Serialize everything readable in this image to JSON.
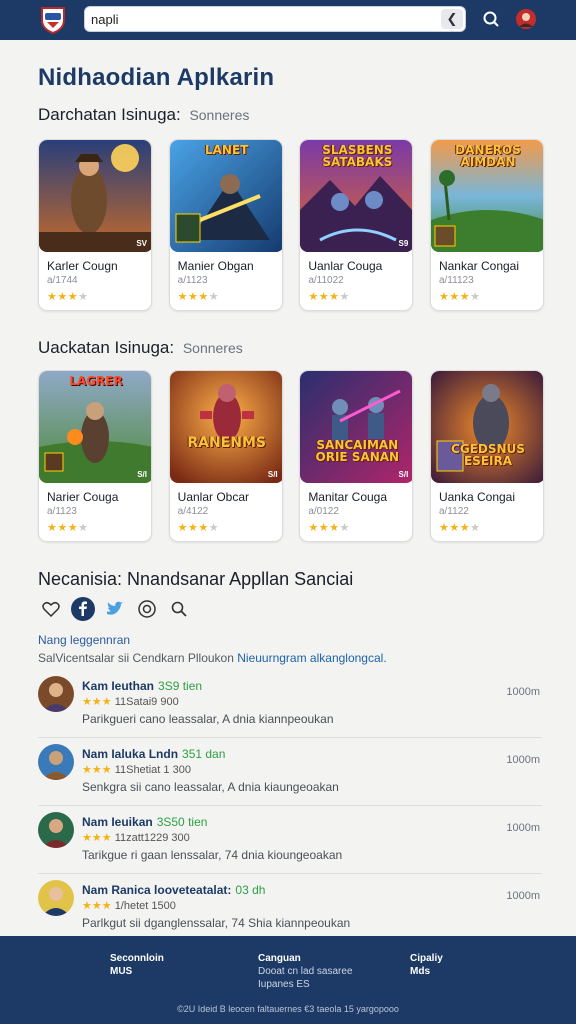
{
  "search": {
    "value": "napli"
  },
  "page_title": "Nidhaodian Aplkarin",
  "sections": [
    {
      "title": "Darchatan Isinuga:",
      "subtitle": "Sonneres",
      "cards": [
        {
          "caption": "",
          "badge": "SV",
          "name": "Karler Cougn",
          "date": "a/1744",
          "rating": 3
        },
        {
          "caption": "LANET",
          "badge": "",
          "name": "Manier Obgan",
          "date": "a/1123",
          "rating": 3
        },
        {
          "caption": "SLASBENS SATABAKS",
          "badge": "S9",
          "name": "Uanlar Couga",
          "date": "a/11022",
          "rating": 3
        },
        {
          "caption": "DANEROS AIMDAN",
          "badge": "",
          "name": "Nankar Congai",
          "date": "a/11123",
          "rating": 3
        }
      ]
    },
    {
      "title": "Uackatan Isinuga:",
      "subtitle": "Sonneres",
      "cards": [
        {
          "caption": "LAGRER",
          "badge": "S/I",
          "name": "Narier Couga",
          "date": "a/1123",
          "rating": 3
        },
        {
          "caption": "RANENMS",
          "badge": "S/I",
          "name": "Uanlar Obcar",
          "date": "a/4122",
          "rating": 3
        },
        {
          "caption": "SANCAIMAN ORIE SANAN",
          "badge": "S/I",
          "name": "Manitar Couga",
          "date": "a/0122",
          "rating": 3
        },
        {
          "caption": "CGEDSNUS ESEIRA",
          "badge": "",
          "name": "Uanka Congai",
          "date": "a/1122",
          "rating": 3
        }
      ]
    }
  ],
  "review_section": {
    "title": "Necanisia: Nnandsanar Appllan Sanciai",
    "link_label": "Nang leggennran",
    "notice_plain": "SalVicentsalar sii Cendkarn Plloukon",
    "notice_highlight": "Nieuurngram alkanglongcal.",
    "reviews": [
      {
        "name": "Kam Ieuthan",
        "tag": "3S9 tien",
        "rating": 3,
        "meta": "11Satai9 900",
        "text": "Parikgueri cano leassalar, A dnia kiannpeoukan",
        "count": "1000m"
      },
      {
        "name": "Nam Ialuka Lndn",
        "tag": "351 dan",
        "rating": 3,
        "meta": "11Shetiat 1 300",
        "text": "Senkgra sii cano leassalar, A dnia kiaungeoakan",
        "count": "1000m"
      },
      {
        "name": "Nam Ieuikan",
        "tag": "3S50 tien",
        "rating": 3,
        "meta": "11zatt1229 300",
        "text": "Tarikgue ri gaan lenssalar, 74 dnia kioungeoakan",
        "count": "1000m"
      },
      {
        "name": "Nam Ranica looveteatalat:",
        "tag": "03 dh",
        "rating": 3,
        "meta": "1/hetet 1500",
        "text": "Parlkgut sii dganglenssalar, 74 Shia kiannpeoukan",
        "count": "1000m"
      }
    ]
  },
  "footer": {
    "col1": {
      "line1": "Seconnloin",
      "line2": "MUS"
    },
    "col2": {
      "line1": "Canguan",
      "line2": "Dooat cn lad sasaree",
      "line3": "Iupanes ES"
    },
    "col3": {
      "line1": "Cipaliy",
      "line2": "Mds"
    },
    "copyright": "©2U Ideid B leocen faltauernes €3 taeola 15 yargopooo"
  },
  "colors": {
    "navy": "#1d3a66",
    "star": "#f3b217",
    "accent_green": "#2ea043"
  },
  "icons": [
    "app-logo-icon",
    "back-arrow-icon",
    "search-icon",
    "avatar-icon",
    "heart-icon",
    "facebook-icon",
    "twitter-icon",
    "instagram-icon",
    "magnifier-icon"
  ]
}
